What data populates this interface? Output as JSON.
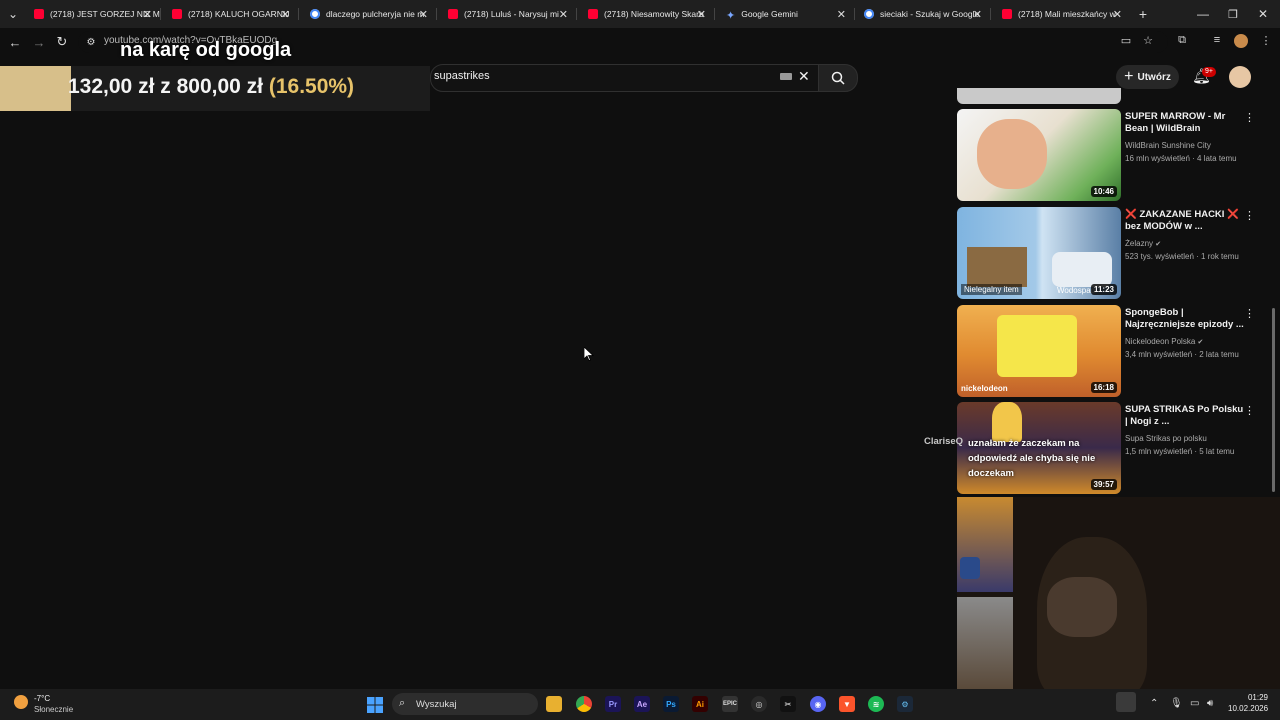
{
  "browser": {
    "tabs": [
      {
        "title": "(2718) JEST GORZEJ NIZ M",
        "fav": "yt"
      },
      {
        "title": "(2718) KALUCH OGARNIJ",
        "fav": "yt"
      },
      {
        "title": "dlaczego pulcheryja nie m",
        "fav": "g"
      },
      {
        "title": "(2718) Luluś - Narysuj mi",
        "fav": "yt"
      },
      {
        "title": "(2718) Niesamowity Skarb",
        "fav": "yt"
      },
      {
        "title": "Google Gemini",
        "fav": "gem"
      },
      {
        "title": "sieciaki - Szukaj w Google",
        "fav": "g"
      },
      {
        "title": "(2718) Mali mieszkańcy w",
        "fav": "yt"
      }
    ],
    "url": "youtube.com/watch?v=OvTBkaEUODg"
  },
  "overlay": {
    "goal_current": "132,00 zł",
    "goal_sep": "z",
    "goal_target": "800,00 zł",
    "goal_percent": "(16.50%)",
    "goal_fraction": 0.165,
    "caption": "na karę od googla"
  },
  "youtube": {
    "search_query": "supastrikes",
    "create_label": "Utwórz",
    "notifications_badge": "9+"
  },
  "videos": [
    {
      "title": "SUPER MARROW - Mr Bean | WildBrain",
      "channel": "WildBrain Sunshine City",
      "meta": "16 mln wyświetleń · 4 lata temu",
      "duration": "10:46",
      "verified": false
    },
    {
      "title": "❌ ZAKAZANE HACKI ❌ bez MODÓW w ...",
      "channel": "Żelazny",
      "meta": "523 tys. wyświetleń · 1 rok temu",
      "duration": "11:23",
      "verified": true,
      "thumb_label_left": "Nielegalny item",
      "thumb_label_right": "Wodospad"
    },
    {
      "title": "SpongeBob | Najzręczniejsze epizody ...",
      "channel": "Nickelodeon Polska",
      "meta": "3,4 mln wyświetleń · 2 lata temu",
      "duration": "16:18",
      "verified": true,
      "thumb_label_left": "nickelodeon"
    },
    {
      "title": "SUPA STRIKAS Po Polsku | Nogi z ...",
      "channel": "Supa Strikas po polsku",
      "meta": "1,5 mln wyświetleń · 5 lat temu",
      "duration": "39:57",
      "verified": false
    }
  ],
  "chat": {
    "user": "ClariseQ",
    "message": "uznałam że zaczekam na odpowiedź ale chyba się nie doczekam"
  },
  "taskbar": {
    "temp": "-7°C",
    "condition": "Słonecznie",
    "search_label": "Wyszukaj",
    "time": "01:29",
    "date": "10.02.2026"
  }
}
